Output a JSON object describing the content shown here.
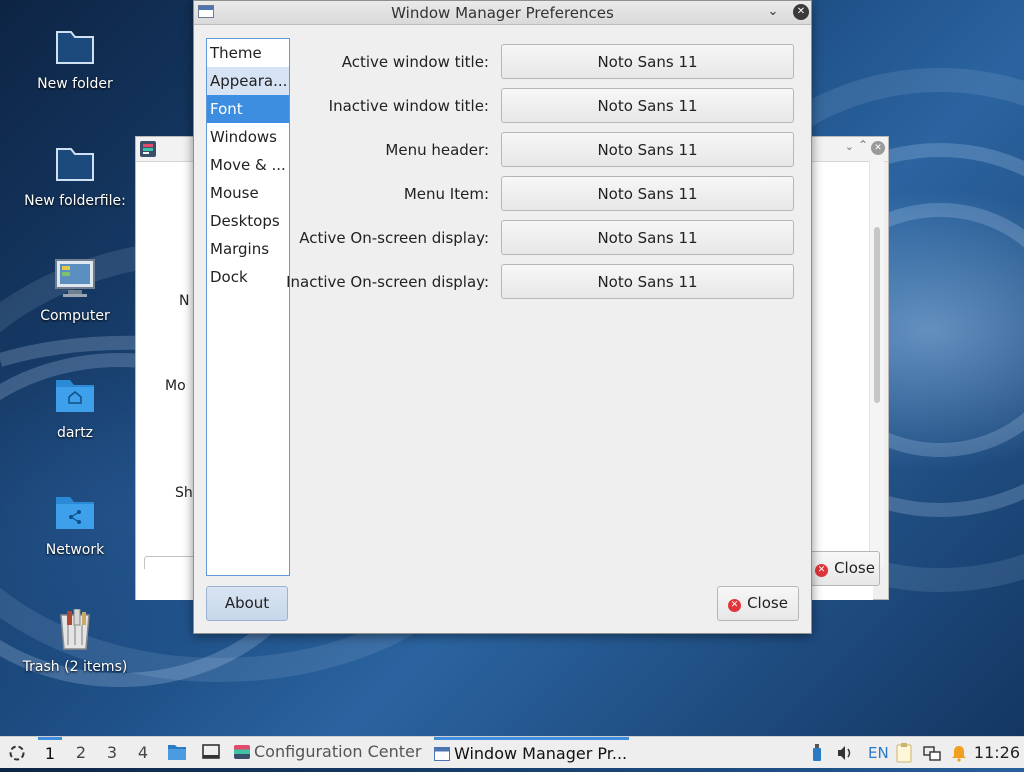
{
  "desktop": {
    "icons": [
      {
        "label": "New folder",
        "icon": "folder-icon"
      },
      {
        "label": "New folderfile:",
        "icon": "folder-icon"
      },
      {
        "label": "Computer",
        "icon": "computer-icon"
      },
      {
        "label": "dartz",
        "icon": "home-folder-icon"
      },
      {
        "label": "Network",
        "icon": "network-folder-icon"
      },
      {
        "label": "Trash (2 items)",
        "icon": "trash-icon"
      }
    ]
  },
  "background_window": {
    "labels": [
      "N",
      "Mo",
      "Sh"
    ],
    "close_label": "Close"
  },
  "dialog": {
    "title": "Window Manager Preferences",
    "nav": [
      {
        "label": "Theme"
      },
      {
        "label": "Appeara..."
      },
      {
        "label": "Font"
      },
      {
        "label": "Windows"
      },
      {
        "label": "Move & ..."
      },
      {
        "label": "Mouse"
      },
      {
        "label": "Desktops"
      },
      {
        "label": "Margins"
      },
      {
        "label": "Dock"
      }
    ],
    "selected_nav": "Font",
    "fonts": [
      {
        "label": "Active window title:",
        "value": "Noto Sans 11"
      },
      {
        "label": "Inactive window title:",
        "value": "Noto Sans 11"
      },
      {
        "label": "Menu header:",
        "value": "Noto Sans 11"
      },
      {
        "label": "Menu Item:",
        "value": "Noto Sans 11"
      },
      {
        "label": "Active On-screen display:",
        "value": "Noto Sans 11"
      },
      {
        "label": "Inactive On-screen display:",
        "value": "Noto Sans 11"
      }
    ],
    "about_label": "About",
    "close_label": "Close"
  },
  "taskbar": {
    "workspaces": [
      "1",
      "2",
      "3",
      "4"
    ],
    "tasks": [
      {
        "label": "Configuration Center"
      },
      {
        "label": "Window Manager Pr..."
      }
    ],
    "keyboard_layout": "EN",
    "clock": "11:26"
  },
  "colors": {
    "accent": "#3d8ee0",
    "close_red": "#e0353b"
  }
}
